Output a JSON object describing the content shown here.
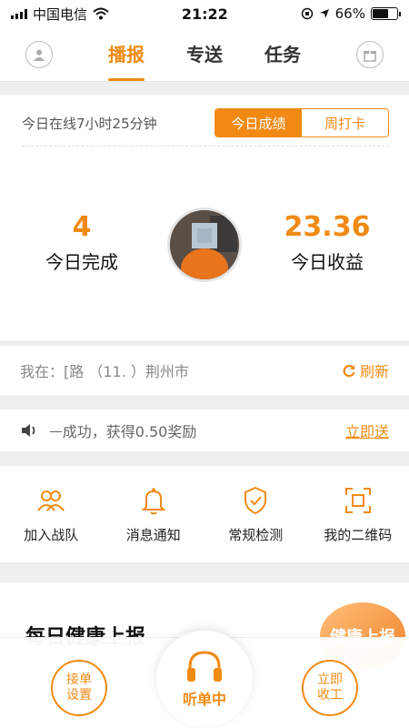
{
  "status_bar": {
    "carrier": "中国电信",
    "time": "21:22",
    "battery": "66%",
    "battery_level": 0.66
  },
  "nav": {
    "tabs": [
      "播报",
      "专送",
      "任务"
    ],
    "active_tab": 0
  },
  "summary": {
    "online_text": "今日在线7小时25分钟",
    "seg_today": "今日成绩",
    "seg_week": "周打卡",
    "completed_value": "4",
    "completed_label": "今日完成",
    "earnings_value": "23.36",
    "earnings_label": "今日收益"
  },
  "location": {
    "text": "我在：[路  （11.            ）荆州市",
    "refresh_label": "刷新"
  },
  "notice": {
    "text": "ᅳ成功，获得0.50奖励",
    "link": "立即送"
  },
  "quick_actions": [
    {
      "label": "加入战队",
      "icon": "team-icon"
    },
    {
      "label": "消息通知",
      "icon": "bell-icon"
    },
    {
      "label": "常规检测",
      "icon": "shield-check-icon"
    },
    {
      "label": "我的二维码",
      "icon": "qr-scan-icon"
    }
  ],
  "health": {
    "title": "每日健康上报",
    "badge": "健康上报"
  },
  "bottom": {
    "left_button": "接单设置",
    "center_button": "听单中",
    "right_button": "立即收工"
  },
  "colors": {
    "accent": "#f08a14"
  }
}
